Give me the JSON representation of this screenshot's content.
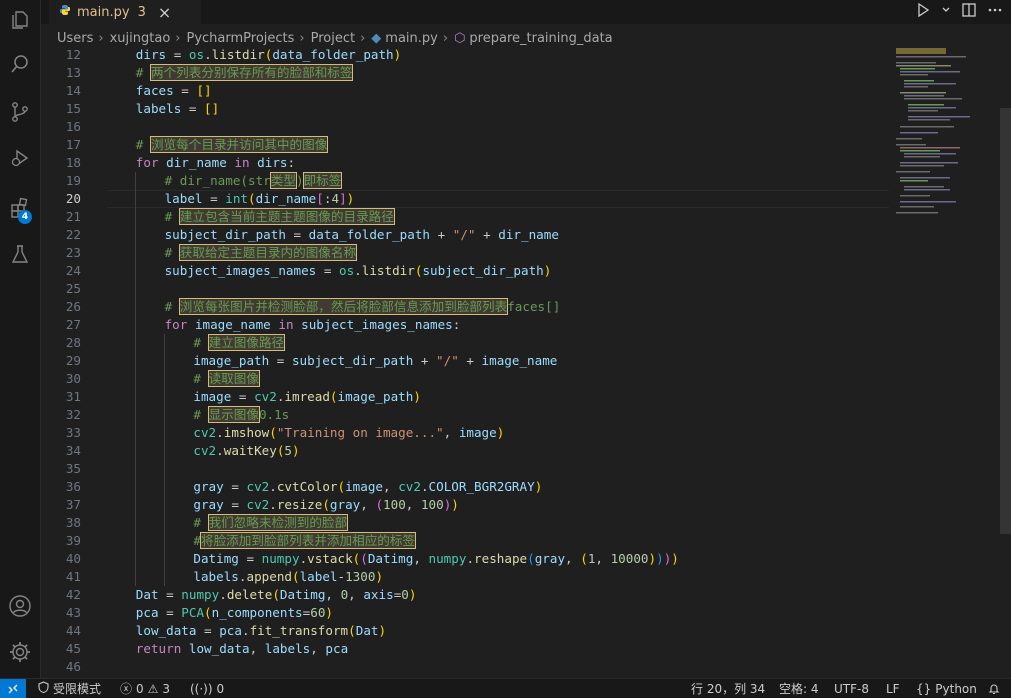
{
  "tab": {
    "filename": "main.py",
    "problems": "3",
    "close": "×"
  },
  "breadcrumb": [
    "Users",
    "xujingtao",
    "PycharmProjects",
    "Project",
    "main.py",
    "prepare_training_data"
  ],
  "activity_badge": "4",
  "editor": {
    "current_line": 20,
    "lines": [
      {
        "n": "12",
        "indent": 1,
        "t": [
          [
            "var",
            "dirs"
          ],
          [
            "p",
            " = "
          ],
          [
            "mod",
            "os"
          ],
          [
            "p",
            "."
          ],
          [
            "fn",
            "listdir"
          ],
          [
            "bp1",
            "("
          ],
          [
            "var",
            "data_folder_path"
          ],
          [
            "bp1",
            ")"
          ]
        ]
      },
      {
        "n": "13",
        "indent": 1,
        "t": [
          [
            "cm",
            "# "
          ],
          [
            "hl",
            "两个列表分别保存所有的脸部和标签"
          ]
        ]
      },
      {
        "n": "14",
        "indent": 1,
        "t": [
          [
            "var",
            "faces"
          ],
          [
            "p",
            " = "
          ],
          [
            "bp1",
            "[]"
          ]
        ]
      },
      {
        "n": "15",
        "indent": 1,
        "t": [
          [
            "var",
            "labels"
          ],
          [
            "p",
            " = "
          ],
          [
            "bp1",
            "[]"
          ]
        ]
      },
      {
        "n": "16",
        "indent": 1,
        "t": []
      },
      {
        "n": "17",
        "indent": 1,
        "t": [
          [
            "cm",
            "# "
          ],
          [
            "hl",
            "浏览每个目录并访问其中的图像"
          ]
        ]
      },
      {
        "n": "18",
        "indent": 1,
        "t": [
          [
            "kw",
            "for"
          ],
          [
            "p",
            " "
          ],
          [
            "var",
            "dir_name"
          ],
          [
            "p",
            " "
          ],
          [
            "kw",
            "in"
          ],
          [
            "p",
            " "
          ],
          [
            "var",
            "dirs"
          ],
          [
            "p",
            ":"
          ]
        ]
      },
      {
        "n": "19",
        "indent": 2,
        "t": [
          [
            "cm",
            "# dir_name(str"
          ],
          [
            "hl",
            "类型"
          ],
          [
            "cm",
            ")"
          ],
          [
            "hl",
            "即标签"
          ]
        ]
      },
      {
        "n": "20",
        "indent": 2,
        "t": [
          [
            "var",
            "label"
          ],
          [
            "p",
            " = "
          ],
          [
            "mod",
            "int"
          ],
          [
            "bp1",
            "("
          ],
          [
            "var",
            "dir_name"
          ],
          [
            "bp2",
            "["
          ],
          [
            "p",
            ":"
          ],
          [
            "num",
            "4"
          ],
          [
            "bp2",
            "]"
          ],
          [
            "bp1",
            ")"
          ]
        ]
      },
      {
        "n": "21",
        "indent": 2,
        "t": [
          [
            "cm",
            "# "
          ],
          [
            "hl",
            "建立包含当前主题主题图像的目录路径"
          ]
        ]
      },
      {
        "n": "22",
        "indent": 2,
        "t": [
          [
            "var",
            "subject_dir_path"
          ],
          [
            "p",
            " = "
          ],
          [
            "var",
            "data_folder_path"
          ],
          [
            "p",
            " + "
          ],
          [
            "str",
            "\"/\""
          ],
          [
            "p",
            " + "
          ],
          [
            "var",
            "dir_name"
          ]
        ]
      },
      {
        "n": "23",
        "indent": 2,
        "t": [
          [
            "cm",
            "# "
          ],
          [
            "hl",
            "获取给定主题目录内的图像名称"
          ]
        ]
      },
      {
        "n": "24",
        "indent": 2,
        "t": [
          [
            "var",
            "subject_images_names"
          ],
          [
            "p",
            " = "
          ],
          [
            "mod",
            "os"
          ],
          [
            "p",
            "."
          ],
          [
            "fn",
            "listdir"
          ],
          [
            "bp1",
            "("
          ],
          [
            "var",
            "subject_dir_path"
          ],
          [
            "bp1",
            ")"
          ]
        ]
      },
      {
        "n": "25",
        "indent": 2,
        "t": []
      },
      {
        "n": "26",
        "indent": 2,
        "t": [
          [
            "cm",
            "# "
          ],
          [
            "hl",
            "浏览每张图片并检测脸部，然后将脸部信息添加到脸部列表"
          ],
          [
            "cm",
            "faces[]"
          ]
        ]
      },
      {
        "n": "27",
        "indent": 2,
        "t": [
          [
            "kw",
            "for"
          ],
          [
            "p",
            " "
          ],
          [
            "var",
            "image_name"
          ],
          [
            "p",
            " "
          ],
          [
            "kw",
            "in"
          ],
          [
            "p",
            " "
          ],
          [
            "var",
            "subject_images_names"
          ],
          [
            "p",
            ":"
          ]
        ]
      },
      {
        "n": "28",
        "indent": 3,
        "t": [
          [
            "cm",
            "# "
          ],
          [
            "hl",
            "建立图像路径"
          ]
        ]
      },
      {
        "n": "29",
        "indent": 3,
        "t": [
          [
            "var",
            "image_path"
          ],
          [
            "p",
            " = "
          ],
          [
            "var",
            "subject_dir_path"
          ],
          [
            "p",
            " + "
          ],
          [
            "str",
            "\"/\""
          ],
          [
            "p",
            " + "
          ],
          [
            "var",
            "image_name"
          ]
        ]
      },
      {
        "n": "30",
        "indent": 3,
        "t": [
          [
            "cm",
            "# "
          ],
          [
            "hl",
            "读取图像"
          ]
        ]
      },
      {
        "n": "31",
        "indent": 3,
        "t": [
          [
            "var",
            "image"
          ],
          [
            "p",
            " = "
          ],
          [
            "mod",
            "cv2"
          ],
          [
            "p",
            "."
          ],
          [
            "fn",
            "imread"
          ],
          [
            "bp1",
            "("
          ],
          [
            "var",
            "image_path"
          ],
          [
            "bp1",
            ")"
          ]
        ]
      },
      {
        "n": "32",
        "indent": 3,
        "t": [
          [
            "cm",
            "# "
          ],
          [
            "hl",
            "显示图像"
          ],
          [
            "cm",
            "0.1s"
          ]
        ]
      },
      {
        "n": "33",
        "indent": 3,
        "t": [
          [
            "mod",
            "cv2"
          ],
          [
            "p",
            "."
          ],
          [
            "fn",
            "imshow"
          ],
          [
            "bp1",
            "("
          ],
          [
            "str",
            "\"Training on image...\""
          ],
          [
            "p",
            ", "
          ],
          [
            "var",
            "image"
          ],
          [
            "bp1",
            ")"
          ]
        ]
      },
      {
        "n": "34",
        "indent": 3,
        "t": [
          [
            "mod",
            "cv2"
          ],
          [
            "p",
            "."
          ],
          [
            "fn",
            "waitKey"
          ],
          [
            "bp1",
            "("
          ],
          [
            "num",
            "5"
          ],
          [
            "bp1",
            ")"
          ]
        ]
      },
      {
        "n": "35",
        "indent": 3,
        "t": []
      },
      {
        "n": "36",
        "indent": 3,
        "t": [
          [
            "var",
            "gray"
          ],
          [
            "p",
            " = "
          ],
          [
            "mod",
            "cv2"
          ],
          [
            "p",
            "."
          ],
          [
            "fn",
            "cvtColor"
          ],
          [
            "bp1",
            "("
          ],
          [
            "var",
            "image"
          ],
          [
            "p",
            ", "
          ],
          [
            "mod",
            "cv2"
          ],
          [
            "p",
            "."
          ],
          [
            "var",
            "COLOR_BGR2GRAY"
          ],
          [
            "bp1",
            ")"
          ]
        ]
      },
      {
        "n": "37",
        "indent": 3,
        "t": [
          [
            "var",
            "gray"
          ],
          [
            "p",
            " = "
          ],
          [
            "mod",
            "cv2"
          ],
          [
            "p",
            "."
          ],
          [
            "fn",
            "resize"
          ],
          [
            "bp1",
            "("
          ],
          [
            "var",
            "gray"
          ],
          [
            "p",
            ", "
          ],
          [
            "bp2",
            "("
          ],
          [
            "num",
            "100"
          ],
          [
            "p",
            ", "
          ],
          [
            "num",
            "100"
          ],
          [
            "bp2",
            ")"
          ],
          [
            "bp1",
            ")"
          ]
        ]
      },
      {
        "n": "38",
        "indent": 3,
        "t": [
          [
            "cm",
            "# "
          ],
          [
            "hl",
            "我们忽略未检测到的脸部"
          ]
        ]
      },
      {
        "n": "39",
        "indent": 3,
        "t": [
          [
            "cm",
            "#"
          ],
          [
            "hl",
            "将脸添加到脸部列表并添加相应的标签"
          ]
        ]
      },
      {
        "n": "40",
        "indent": 3,
        "t": [
          [
            "var",
            "Datimg"
          ],
          [
            "p",
            " = "
          ],
          [
            "mod",
            "numpy"
          ],
          [
            "p",
            "."
          ],
          [
            "fn",
            "vstack"
          ],
          [
            "bp1",
            "("
          ],
          [
            "bp2",
            "("
          ],
          [
            "var",
            "Datimg"
          ],
          [
            "p",
            ", "
          ],
          [
            "mod",
            "numpy"
          ],
          [
            "p",
            "."
          ],
          [
            "fn",
            "reshape"
          ],
          [
            "bp3",
            "("
          ],
          [
            "var",
            "gray"
          ],
          [
            "p",
            ", "
          ],
          [
            "bp1",
            "("
          ],
          [
            "num",
            "1"
          ],
          [
            "p",
            ", "
          ],
          [
            "num",
            "10000"
          ],
          [
            "bp1",
            ")"
          ],
          [
            "bp3",
            ")"
          ],
          [
            "bp2",
            ")"
          ],
          [
            "bp1",
            ")"
          ]
        ]
      },
      {
        "n": "41",
        "indent": 3,
        "t": [
          [
            "var",
            "labels"
          ],
          [
            "p",
            "."
          ],
          [
            "fn",
            "append"
          ],
          [
            "bp1",
            "("
          ],
          [
            "var",
            "label"
          ],
          [
            "p",
            "-"
          ],
          [
            "num",
            "1300"
          ],
          [
            "bp1",
            ")"
          ]
        ]
      },
      {
        "n": "42",
        "indent": 1,
        "t": [
          [
            "var",
            "Dat"
          ],
          [
            "p",
            " = "
          ],
          [
            "mod",
            "numpy"
          ],
          [
            "p",
            "."
          ],
          [
            "fn",
            "delete"
          ],
          [
            "bp1",
            "("
          ],
          [
            "var",
            "Datimg"
          ],
          [
            "p",
            ", "
          ],
          [
            "num",
            "0"
          ],
          [
            "p",
            ", "
          ],
          [
            "var",
            "axis"
          ],
          [
            "p",
            "="
          ],
          [
            "num",
            "0"
          ],
          [
            "bp1",
            ")"
          ]
        ]
      },
      {
        "n": "43",
        "indent": 1,
        "t": [
          [
            "var",
            "pca"
          ],
          [
            "p",
            " = "
          ],
          [
            "mod",
            "PCA"
          ],
          [
            "bp1",
            "("
          ],
          [
            "var",
            "n_components"
          ],
          [
            "p",
            "="
          ],
          [
            "num",
            "60"
          ],
          [
            "bp1",
            ")"
          ]
        ]
      },
      {
        "n": "44",
        "indent": 1,
        "t": [
          [
            "var",
            "low_data"
          ],
          [
            "p",
            " = "
          ],
          [
            "var",
            "pca"
          ],
          [
            "p",
            "."
          ],
          [
            "fn",
            "fit_transform"
          ],
          [
            "bp1",
            "("
          ],
          [
            "var",
            "Dat"
          ],
          [
            "bp1",
            ")"
          ]
        ]
      },
      {
        "n": "45",
        "indent": 1,
        "t": [
          [
            "kw",
            "return"
          ],
          [
            "p",
            " "
          ],
          [
            "var",
            "low_data"
          ],
          [
            "p",
            ", "
          ],
          [
            "var",
            "labels"
          ],
          [
            "p",
            ", "
          ],
          [
            "var",
            "pca"
          ]
        ]
      },
      {
        "n": "46",
        "indent": 1,
        "t": []
      }
    ]
  },
  "status": {
    "restricted": "受限模式",
    "errors": "0",
    "warnings": "3",
    "ports": "0",
    "position": "行 20，列 34",
    "spaces": "空格: 4",
    "encoding": "UTF-8",
    "eol": "LF",
    "language": "Python"
  },
  "colors": {
    "accent": "#0078d4",
    "modified": "#e2c08d",
    "highlight_border": "#d7ba7d"
  }
}
